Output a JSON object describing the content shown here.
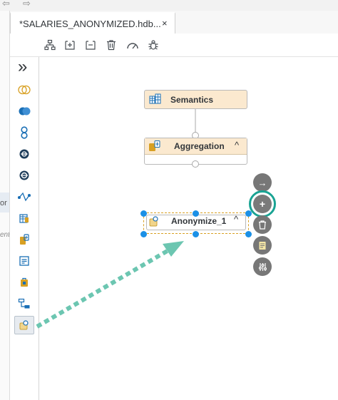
{
  "tab": {
    "title": "*SALARIES_ANONYMIZED.hdb...",
    "close": "×"
  },
  "nav": {
    "back": "⇦",
    "forward": "⇨"
  },
  "left_panel": {
    "text_1": "or",
    "text_2": "ent"
  },
  "toolbar": {
    "icons": [
      "auto-layout-icon",
      "expand-icon",
      "collapse-icon",
      "delete-icon",
      "performance-icon",
      "debug-icon"
    ]
  },
  "palette": {
    "collapse_label": "»",
    "items": [
      "join-icon",
      "union-icon",
      "projection-icon",
      "aggregation-icon",
      "rank-icon",
      "graph-icon",
      "table-function-icon",
      "non-equi-join-icon",
      "minus-icon",
      "intersect-icon",
      "hierarchy-function-icon",
      "anonymization-icon"
    ]
  },
  "nodes": {
    "semantics": {
      "label": "Semantics"
    },
    "aggregation": {
      "label": "Aggregation",
      "toggle": "^"
    },
    "anonymize": {
      "label": "Anonymize_1",
      "toggle": "^"
    }
  },
  "actions": {
    "connect": "→",
    "add": "+"
  },
  "colors": {
    "node_fill": "#fbe9cf",
    "handle_blue": "#1b90e6",
    "highlight_teal": "#19a393",
    "drag_arrow": "#6cc6b1"
  }
}
